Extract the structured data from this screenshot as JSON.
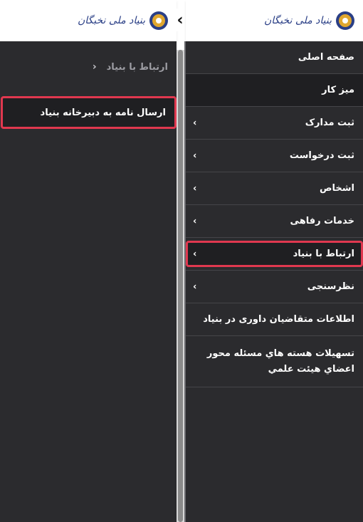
{
  "logo": {
    "text": "بنیاد ملی نخبگان"
  },
  "left_panel": {
    "breadcrumb": {
      "label": "ارتباط با بنیاد",
      "icon": "chevron-left-icon"
    },
    "items": [
      {
        "label": "ارسال نامه به دبیرخانه بنیاد",
        "highlighted": true
      }
    ]
  },
  "toggle": {
    "icon": "chevron-left-icon",
    "glyph": "‹"
  },
  "right_panel": {
    "menu": [
      {
        "label": "صفحه اصلی",
        "has_submenu": false
      },
      {
        "label": "میز کار",
        "has_submenu": false
      },
      {
        "label": "ثبت مدارک",
        "has_submenu": true
      },
      {
        "label": "ثبت درخواست",
        "has_submenu": true
      },
      {
        "label": "اشخاص",
        "has_submenu": true
      },
      {
        "label": "خدمات رفاهی",
        "has_submenu": true
      },
      {
        "label": "ارتباط با بنیاد",
        "has_submenu": true,
        "highlighted": true
      },
      {
        "label": "نظرسنجی",
        "has_submenu": true
      },
      {
        "label": "اطلاعات متقاضیان داوری در بنیاد",
        "has_submenu": false
      },
      {
        "label": "تسهیلات هسته هاي مسئله محور اعضاي هیئت علمي",
        "has_submenu": false
      }
    ]
  },
  "colors": {
    "sidebar_bg": "#2b2b2e",
    "highlight_border": "#e0384f",
    "text": "#ffffff"
  }
}
